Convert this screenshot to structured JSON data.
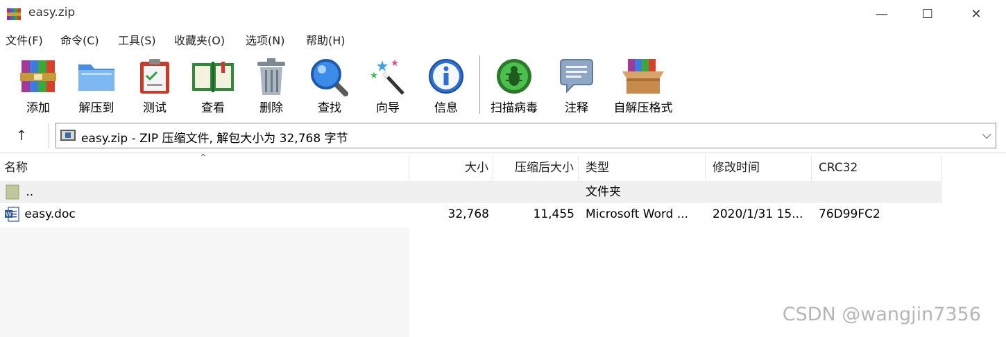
{
  "window": {
    "title": "easy.zip",
    "minimize_glyph": "—",
    "maximize_glyph": "☐",
    "close_glyph": "✕"
  },
  "menu": [
    "文件(F)",
    "命令(C)",
    "工具(S)",
    "收藏夹(O)",
    "选项(N)",
    "帮助(H)"
  ],
  "toolbar": {
    "add": "添加",
    "extract": "解压到",
    "test": "测试",
    "view": "查看",
    "delete": "删除",
    "find": "查找",
    "wizard": "向导",
    "info": "信息",
    "virus_scan": "扫描病毒",
    "comment": "注释",
    "sfx": "自解压格式"
  },
  "address": {
    "up_glyph": "↑",
    "text": "easy.zip - ZIP 压缩文件, 解包大小为 32,768 字节",
    "dropdown_glyph": "⌵"
  },
  "columns": {
    "name": "名称",
    "size": "大小",
    "packed": "压缩后大小",
    "type": "类型",
    "modified": "修改时间",
    "crc": "CRC32",
    "sort_glyph": "⌃"
  },
  "rows": [
    {
      "name": "..",
      "size": "",
      "packed": "",
      "type": "文件夹",
      "modified": "",
      "crc": ""
    },
    {
      "name": "easy.doc",
      "size": "32,768",
      "packed": "11,455",
      "type": "Microsoft Word ...",
      "modified": "2020/1/31 15...",
      "crc": "76D99FC2"
    }
  ],
  "watermark": "CSDN @wangjin7356",
  "colors": {
    "header_row": "#f0f0f0",
    "parent_row": "#f0f0f0",
    "accent": "#1a73c8"
  }
}
